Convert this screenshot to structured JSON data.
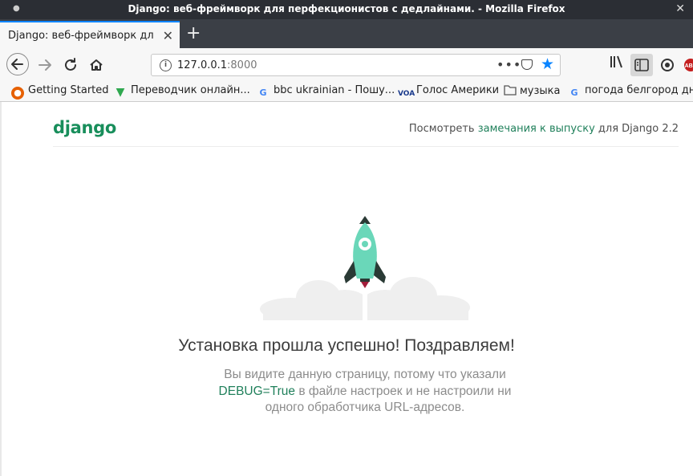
{
  "window": {
    "title": "Django: веб-фреймворк для перфекционистов с дедлайнами. - Mozilla Firefox"
  },
  "tab": {
    "label": "Django: веб-фреймворк для п"
  },
  "urlbar": {
    "host": "127.0.0.1",
    "port": ":8000",
    "bookmark_star_color": "#0a84ff"
  },
  "bookmarks": [
    {
      "label": "Getting Started",
      "icon": "firefox-icon"
    },
    {
      "label": "Переводчик онлайн...",
      "icon": "translator-icon"
    },
    {
      "label": "bbc ukrainian - Пошу...",
      "icon": "google-icon"
    },
    {
      "label": "Голос Америки",
      "icon": "voa-icon"
    },
    {
      "label": "музыка",
      "icon": "folder-icon"
    },
    {
      "label": "погода белгород дн...",
      "icon": "google-icon"
    }
  ],
  "page": {
    "logo": "django",
    "release_prefix": "Посмотреть",
    "release_link": "замечания к выпуску",
    "release_suffix": "для Django 2.2",
    "headline": "Установка прошла успешно! Поздравляем!",
    "desc_line1": "Вы видите данную страницу, потому что указали",
    "desc_debug": "DEBUG=True",
    "desc_line2": "в файле настроек и не настроили ни",
    "desc_line3": "одного обработчика URL-адресов.",
    "accent_color": "#188e5b"
  }
}
